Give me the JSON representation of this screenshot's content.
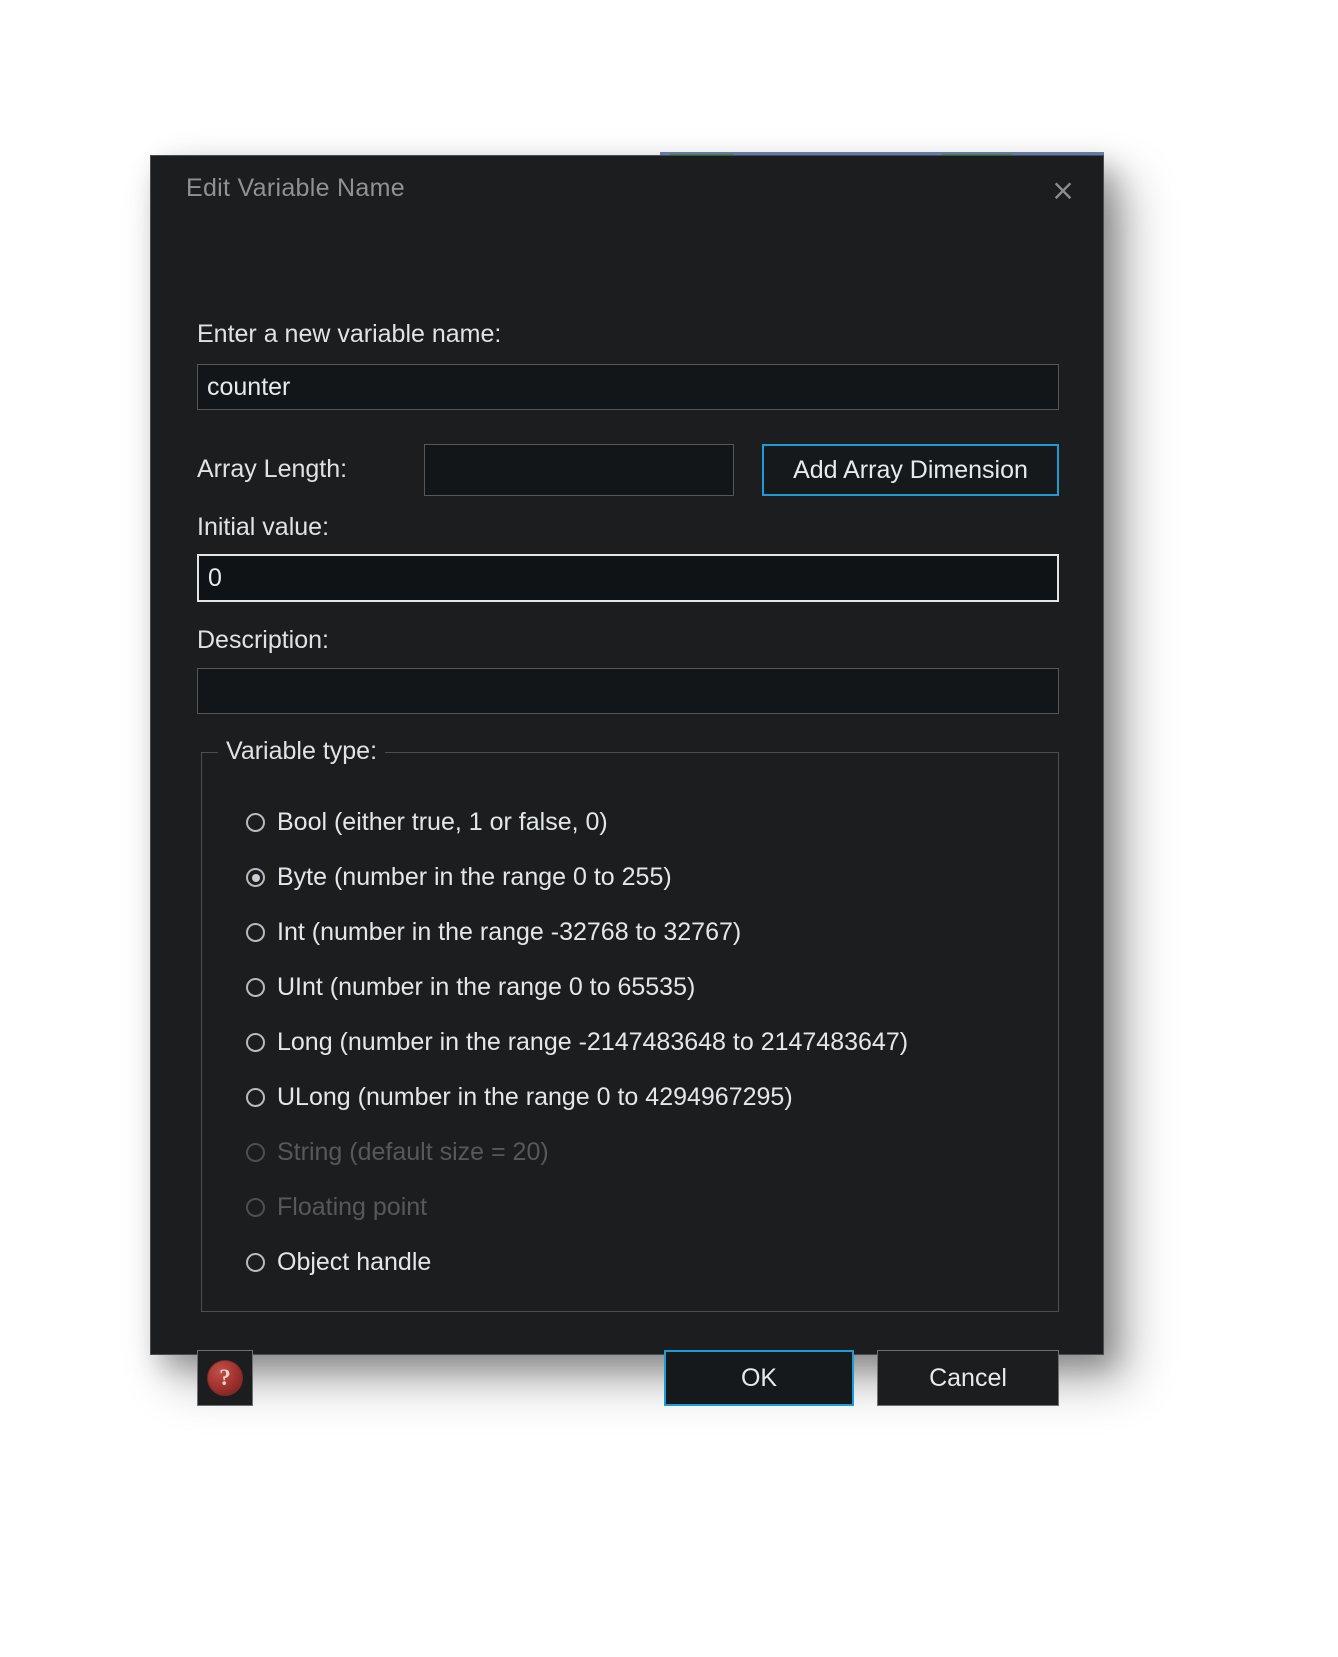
{
  "dialog": {
    "title": "Edit Variable Name",
    "close_icon": "close-icon",
    "close_glyph": "×",
    "accent_color": "#1e9ad6",
    "background_color": "#1b1d1f",
    "text_color": "#e3e7ea",
    "disabled_text_color": "#56595c"
  },
  "fields": {
    "name_label": "Enter a new variable name:",
    "name_value": "counter",
    "name_placeholder": "",
    "array_length_label": "Array Length:",
    "array_length_value": "",
    "array_length_placeholder": "",
    "add_array_dimension_label": "Add Array Dimension",
    "initial_value_label": "Initial value:",
    "initial_value_value": "0",
    "initial_value_placeholder": "",
    "description_label": "Description:",
    "description_value": "",
    "description_placeholder": ""
  },
  "variable_type": {
    "legend": "Variable type:",
    "selected": "Byte",
    "options": [
      {
        "id": "bool",
        "label": "Bool (either true, 1 or false, 0)",
        "checked": false,
        "disabled": false
      },
      {
        "id": "byte",
        "label": "Byte (number in the range 0 to 255)",
        "checked": true,
        "disabled": false
      },
      {
        "id": "int",
        "label": "Int (number in the range -32768 to 32767)",
        "checked": false,
        "disabled": false
      },
      {
        "id": "uint",
        "label": "UInt (number in the range 0 to 65535)",
        "checked": false,
        "disabled": false
      },
      {
        "id": "long",
        "label": "Long (number in the range -2147483648 to 2147483647)",
        "checked": false,
        "disabled": false
      },
      {
        "id": "ulong",
        "label": "ULong (number in the range 0 to 4294967295)",
        "checked": false,
        "disabled": false
      },
      {
        "id": "string",
        "label": "String (default size = 20)",
        "checked": false,
        "disabled": true
      },
      {
        "id": "float",
        "label": "Floating point",
        "checked": false,
        "disabled": true
      },
      {
        "id": "object",
        "label": "Object handle",
        "checked": false,
        "disabled": false
      }
    ]
  },
  "footer": {
    "help_label": "?",
    "ok_label": "OK",
    "cancel_label": "Cancel"
  }
}
